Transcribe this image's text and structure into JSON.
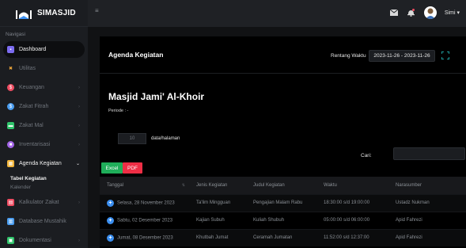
{
  "brand": {
    "name": "SIMASJID"
  },
  "sidebar": {
    "nav_label": "Navigasi",
    "items": [
      {
        "label": "Dashboard",
        "icon": "dashboard-icon",
        "color": "#7c6cf0"
      },
      {
        "label": "Utilitas",
        "icon": "tools-icon",
        "color": "#f2a93b"
      },
      {
        "label": "Keuangan",
        "icon": "money-icon",
        "color": "#ef4d62"
      },
      {
        "label": "Zakat Fitrah",
        "icon": "zakat-icon",
        "color": "#4a9df0"
      },
      {
        "label": "Zakat Mal",
        "icon": "money-bill-icon",
        "color": "#2fc36a"
      },
      {
        "label": "Inventarisasi",
        "icon": "box-icon",
        "color": "#a466e8"
      },
      {
        "label": "Agenda Kegiatan",
        "icon": "calendar-icon",
        "color": "#f2b53b"
      },
      {
        "label": "Kalkulator Zakat",
        "icon": "calculator-icon",
        "color": "#ef4d62"
      },
      {
        "label": "Database Mustahik",
        "icon": "database-icon",
        "color": "#4a9df0"
      },
      {
        "label": "Dokumentasi",
        "icon": "image-icon",
        "color": "#2fc36a"
      }
    ],
    "submenu": [
      "Tabel Kegiatan",
      "Kalender"
    ]
  },
  "topbar": {
    "user_name": "Simi"
  },
  "card": {
    "title": "Agenda Kegiatan",
    "range_label": "Rentang Waktu",
    "range_value": "2023-11-26 - 2023-11-26",
    "mosque_name": "Masjid Jami' Al-Khoir",
    "periode": "Periode : -",
    "per_page_value": "10",
    "per_page_label": "data/halaman",
    "search_label": "Cari:",
    "excel_label": "Excel",
    "pdf_label": "PDF"
  },
  "table": {
    "columns": [
      "Tanggal",
      "Jenis Kegiatan",
      "Judul Kegiatan",
      "Waktu",
      "Narasumber"
    ],
    "rows": [
      [
        "Selasa, 28 November 2023",
        "Ta'lim Mingguan",
        "Pengajian Malam Rabu",
        "18:30:00 s/d 19:00:00",
        "Ustadz Nukman"
      ],
      [
        "Sabtu, 02 Desember 2023",
        "Kajian Subuh",
        "Kuliah Shubuh",
        "05:00:00 s/d 06:00:00",
        "Apid Fahrezi"
      ],
      [
        "Jumat, 08 Desember 2023",
        "Khutbah Jumat",
        "Ceramah Jumatan",
        "11:52:00 s/d 12:37:00",
        "Apid Fahrezi"
      ]
    ]
  }
}
